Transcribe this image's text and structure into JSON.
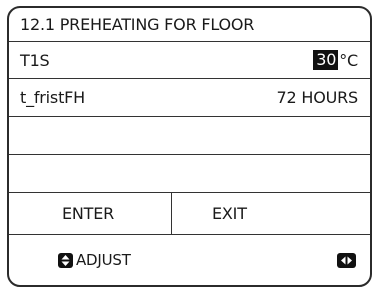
{
  "title": "12.1 PREHEATING FOR FLOOR",
  "rows": [
    {
      "label": "T1S",
      "value": "30",
      "unit": "°C",
      "selected": true
    },
    {
      "label": "t_fristFH",
      "value": "72 HOURS"
    }
  ],
  "buttons": {
    "enter": "ENTER",
    "exit": "EXIT"
  },
  "footer": {
    "adjust_label": "ADJUST",
    "adjust_icon": "up-down-arrows-icon",
    "nav_icon": "left-right-arrows-icon"
  }
}
